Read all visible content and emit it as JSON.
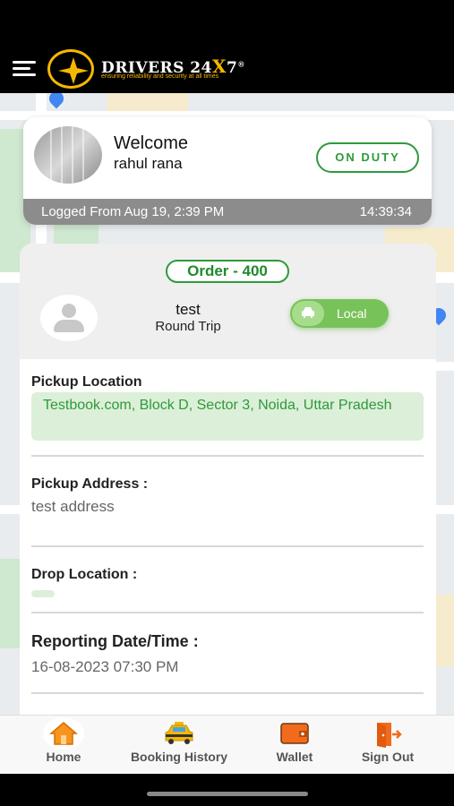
{
  "header": {
    "brand_main": "DRIVERS 24",
    "brand_x": "X",
    "brand_suffix": "7",
    "brand_reg": "®",
    "tagline": "ensuring reliability and security at all times"
  },
  "welcome": {
    "greeting": "Welcome",
    "user_name": "rahul rana",
    "status": "ON DUTY",
    "login_text": "Logged From Aug 19, 2:39 PM",
    "timer": "14:39:34"
  },
  "order": {
    "badge": "Order - 400",
    "customer_name": "test",
    "trip_type": "Round Trip",
    "category": "Local",
    "pickup_location_label": "Pickup Location",
    "pickup_location_value": "Testbook.com, Block D, Sector 3, Noida, Uttar Pradesh",
    "pickup_address_label": "Pickup Address :",
    "pickup_address_value": "test address",
    "drop_location_label": "Drop Location :",
    "drop_location_value": "",
    "reporting_label": "Reporting Date/Time :",
    "reporting_value": "16-08-2023 07:30 PM"
  },
  "nav": {
    "items": [
      {
        "label": "Home",
        "icon": "home-icon"
      },
      {
        "label": "Booking History",
        "icon": "taxi-icon"
      },
      {
        "label": "Wallet",
        "icon": "wallet-icon"
      },
      {
        "label": "Sign Out",
        "icon": "sign-out-icon"
      }
    ]
  },
  "colors": {
    "accent_green": "#2e9a3b",
    "brand_gold": "#f5b800",
    "pickup_bg": "#dcefd8"
  }
}
